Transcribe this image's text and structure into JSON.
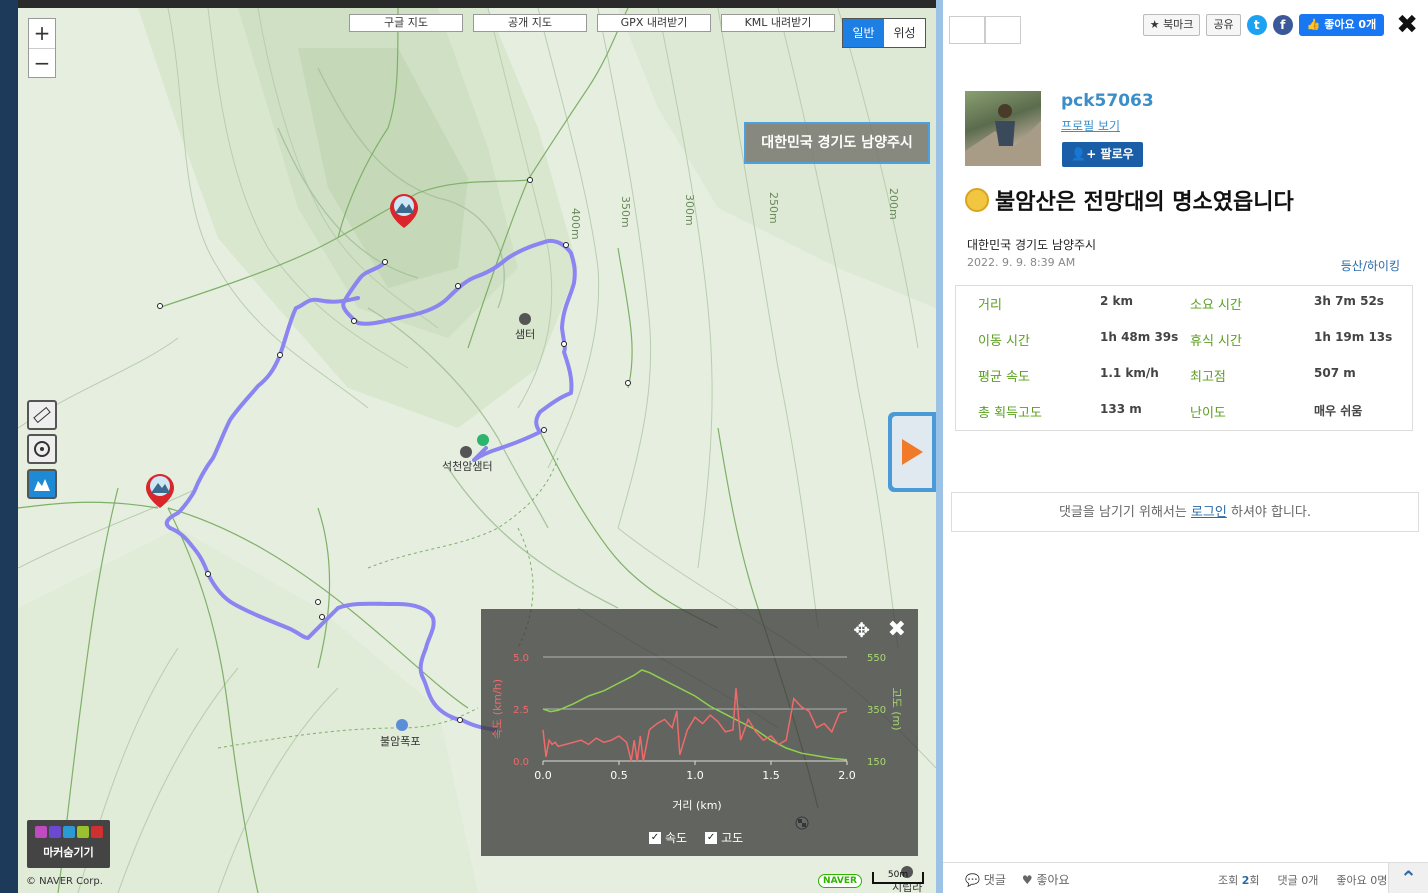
{
  "map": {
    "zoom_in": "+",
    "zoom_out": "−",
    "top_buttons": [
      "구글 지도",
      "공개 지도",
      "GPX 내려받기",
      "KML 내려받기"
    ],
    "map_types": [
      "일반",
      "위성"
    ],
    "region_label": "대한민국 경기도 남양주시",
    "place_labels": {
      "center": "샘터",
      "seokcheon": "석천암샘터",
      "falls": "불암폭포",
      "sigeori": "시립라"
    },
    "contour_labels": [
      "400m",
      "350m",
      "300m",
      "250m",
      "200m"
    ],
    "marker_tool_label": "마커숨기기",
    "copyright": "© NAVER Corp.",
    "naver": "NAVER",
    "scale": "50m"
  },
  "chart": {
    "legend_speed": "속도",
    "legend_elev": "고도",
    "check": "✓",
    "close": "✖",
    "move": "✥"
  },
  "chart_data": {
    "type": "line",
    "xlabel": "거리 (km)",
    "ylabel_left": "속도 (km/h)",
    "ylabel_right": "고도 (m)",
    "x_ticks": [
      "0.0",
      "0.5",
      "1.0",
      "1.5",
      "2.0"
    ],
    "left_ticks": [
      "0.0",
      "2.5",
      "5.0"
    ],
    "right_ticks": [
      "150",
      "350",
      "550"
    ],
    "xlim": [
      0,
      2.0
    ],
    "ylim_left": [
      0,
      5.0
    ],
    "ylim_right": [
      150,
      550
    ],
    "series": [
      {
        "name": "고도",
        "axis": "right",
        "color": "#8fd14f",
        "x": [
          0.0,
          0.05,
          0.1,
          0.2,
          0.3,
          0.4,
          0.5,
          0.6,
          0.65,
          0.7,
          0.8,
          0.9,
          1.0,
          1.1,
          1.2,
          1.3,
          1.4,
          1.5,
          1.6,
          1.7,
          1.8,
          1.9,
          2.0
        ],
        "y": [
          350,
          340,
          345,
          370,
          400,
          420,
          450,
          480,
          500,
          490,
          460,
          430,
          400,
          360,
          330,
          300,
          270,
          230,
          200,
          180,
          170,
          160,
          155
        ]
      },
      {
        "name": "속도",
        "axis": "left",
        "color": "#f06a6a",
        "x": [
          0.0,
          0.02,
          0.04,
          0.06,
          0.08,
          0.1,
          0.15,
          0.2,
          0.25,
          0.3,
          0.35,
          0.4,
          0.45,
          0.5,
          0.55,
          0.58,
          0.6,
          0.62,
          0.64,
          0.66,
          0.7,
          0.75,
          0.8,
          0.85,
          0.88,
          0.9,
          0.95,
          1.0,
          1.05,
          1.1,
          1.15,
          1.2,
          1.25,
          1.27,
          1.3,
          1.35,
          1.4,
          1.45,
          1.5,
          1.55,
          1.6,
          1.65,
          1.7,
          1.75,
          1.8,
          1.85,
          1.9,
          1.95,
          2.0
        ],
        "y": [
          1.5,
          0.2,
          1.0,
          0.8,
          0.9,
          0.7,
          0.8,
          0.9,
          1.0,
          0.8,
          1.1,
          0.9,
          1.0,
          1.2,
          0.9,
          0.0,
          1.0,
          0.0,
          1.2,
          0.0,
          1.5,
          1.8,
          2.0,
          1.6,
          2.4,
          0.3,
          1.5,
          2.1,
          1.8,
          2.2,
          1.9,
          1.4,
          1.5,
          3.5,
          1.0,
          2.0,
          1.4,
          1.0,
          1.2,
          0.8,
          1.0,
          3.0,
          2.6,
          2.4,
          1.6,
          1.8,
          1.4,
          2.3,
          2.4
        ]
      }
    ]
  },
  "panel": {
    "bookmark": "북마크",
    "share": "공유",
    "twitter": "t",
    "facebook": "f",
    "fb_like": "좋아요 0개",
    "close": "✖",
    "username": "pck57063",
    "profile_link": "프로필 보기",
    "follow": "팔로우",
    "title": "불암산은 전망대의 명소였읍니다",
    "location": "대한민국 경기도 남양주시",
    "datetime": "2022. 9. 9. 8:39 AM",
    "category": "등산/하이킹",
    "stats": [
      {
        "label": "거리",
        "value": "2 km",
        "label2": "소요 시간",
        "value2": "3h 7m 52s"
      },
      {
        "label": "이동 시간",
        "value": "1h 48m 39s",
        "label2": "휴식 시간",
        "value2": "1h 19m 13s"
      },
      {
        "label": "평균 속도",
        "value": "1.1 km/h",
        "label2": "최고점",
        "value2": "507 m"
      },
      {
        "label": "총 획득고도",
        "value": "133 m",
        "label2": "난이도",
        "value2": "매우 쉬움"
      }
    ],
    "comment_prefix": "댓글을 남기기 위해서는 ",
    "comment_link": "로그인",
    "comment_suffix": " 하셔야 합니다.",
    "footer": {
      "comments": "댓글",
      "likes": "좋아요",
      "views_label": "조회",
      "views": "2",
      "views_unit": "회",
      "comment_count": "댓글 0개",
      "like_count": "좋아요 0명",
      "up": "⌃"
    }
  }
}
